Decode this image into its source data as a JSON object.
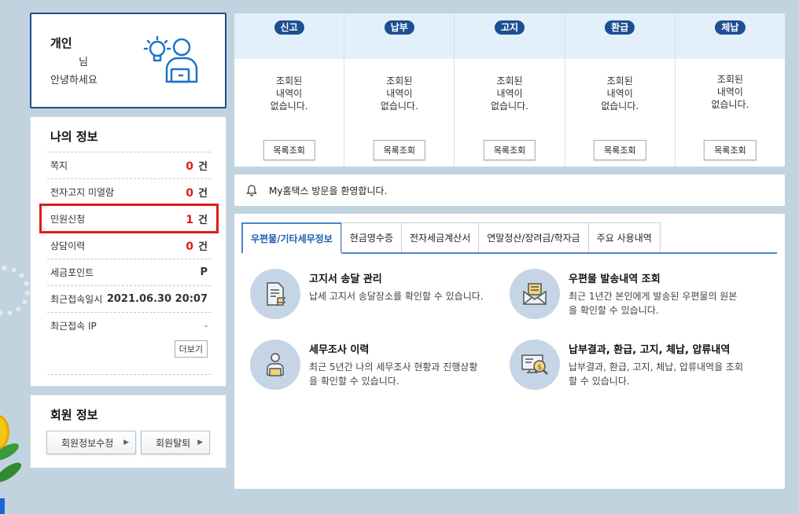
{
  "greeting": {
    "title": "개인",
    "name_suffix": "님",
    "hello": "안녕하세요"
  },
  "my_info": {
    "title": "나의 정보",
    "rows": [
      {
        "label": "쪽지",
        "count": "0",
        "unit": "건"
      },
      {
        "label": "전자고지 미열람",
        "count": "0",
        "unit": "건"
      },
      {
        "label": "민원신청",
        "count": "1",
        "unit": "건"
      },
      {
        "label": "상담이력",
        "count": "0",
        "unit": "건"
      },
      {
        "label": "세금포인트",
        "value": "P"
      },
      {
        "label": "최근접속일시",
        "value": "2021.06.30 20:07"
      },
      {
        "label": "최근접속 IP",
        "value": "-"
      }
    ],
    "more_label": "더보기"
  },
  "member_info": {
    "title": "회원 정보",
    "edit_label": "회원정보수정",
    "withdraw_label": "회원탈퇴"
  },
  "status": [
    {
      "badge": "신고",
      "text": "조회된\n내역이\n없습니다.",
      "button": "목록조회"
    },
    {
      "badge": "납부",
      "text": "조회된\n내역이\n없습니다.",
      "button": "목록조회"
    },
    {
      "badge": "고지",
      "text": "조회된\n내역이\n없습니다.",
      "button": "목록조회"
    },
    {
      "badge": "환급",
      "text": "조회된\n내역이\n없습니다.",
      "button": "목록조회"
    },
    {
      "badge": "체납",
      "text": "조회된\n내역이\n없습니다.",
      "button": "목록조회"
    }
  ],
  "welcome": {
    "text": "My홈택스 방문을 환영합니다."
  },
  "tabs": [
    {
      "label": "우편물/기타세무정보",
      "active": true
    },
    {
      "label": "현금영수증"
    },
    {
      "label": "전자세금계산서"
    },
    {
      "label": "연말정산/장려금/학자금"
    },
    {
      "label": "주요 사용내역"
    }
  ],
  "services": [
    {
      "title": "고지서 송달 관리",
      "desc": "납세 고지서 송달장소를 확인할 수 있습니다.",
      "icon": "document-flag-icon"
    },
    {
      "title": "우편물 발송내역 조회",
      "desc": "최근 1년간 본인에게 발송된 우편물의 원본을 확인할 수 있습니다.",
      "icon": "envelope-icon"
    },
    {
      "title": "세무조사 이력",
      "desc": "최근 5년간 나의 세무조사 현황과 진행상황을 확인할 수 있습니다.",
      "icon": "person-laptop-icon"
    },
    {
      "title": "납부결과, 환급, 고지, 체납, 압류내역",
      "desc": "납부결과, 환급, 고지, 체납, 압류내역을 조회할 수 있습니다.",
      "icon": "monitor-dollar-search-icon"
    }
  ],
  "colors": {
    "accent": "#1d4f91",
    "highlight": "#e11b1b",
    "tab_active": "#1d5fae",
    "background": "#c2d3e0"
  }
}
